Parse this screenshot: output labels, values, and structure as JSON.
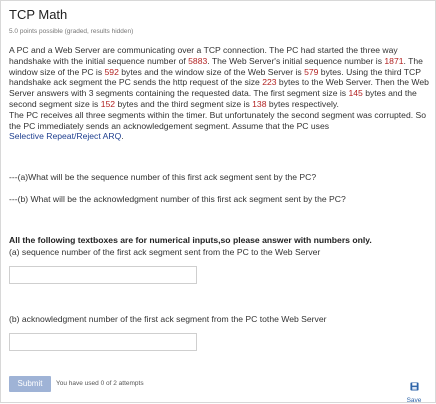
{
  "header": {
    "title": "TCP Math",
    "points": "5.0 points possible (graded, results hidden)"
  },
  "problem": {
    "s1": "A PC and a Web Server are communicating over a TCP connection. The PC had started the three way handshake with the initial sequence number of ",
    "pc_isn": "5883",
    "s2": ". The Web Server's initial sequence number is ",
    "server_isn": "1871",
    "s3": ". The window size of the PC is ",
    "pc_window": "592",
    "s4": " bytes and the window size of the Web Server is ",
    "server_window": "579",
    "s5": " bytes. Using the third TCP handshake ack segment the PC sends the http request of the size ",
    "request_size": "223",
    "s6": " bytes to the Web Server. Then the Web Server answers with 3 segments containing the requested data. The first segment size is ",
    "seg1": "145",
    "s7": " bytes and the second segment size is ",
    "seg2": "152",
    "s8": " bytes and the third segment size is ",
    "seg3": "138",
    "s9": " bytes respectively.",
    "p2": "The PC receives all three segments within the timer. But unfortunately the second segment was corrupted. So the PC immediately sends an acknowledgement segment. Assume that the PC uses ",
    "link_text": "Selective Repeat/Reject ARQ",
    "p2_end": "."
  },
  "questions": {
    "qa": "---(a)What will be the sequence number of this first ack segment sent by the PC?",
    "qb": "---(b) What will be the acknowledgment number of this first ack segment sent by the PC?",
    "instruction": "All the following textboxes are for numerical inputs,so please answer with numbers only.",
    "label_a": "(a) sequence number of the first ack segment sent from the PC to the Web Server",
    "label_b": "(b) acknowledgment number of the first ack segment from the PC tothe Web Server"
  },
  "inputs": {
    "a_value": "",
    "b_value": ""
  },
  "footer": {
    "submit_label": "Submit",
    "attempts": "You have used 0 of 2 attempts",
    "save_label": "Save"
  },
  "colors": {
    "number": "#b22222",
    "link": "#1f3f8f",
    "submit_bg": "#9fb3d6",
    "save_icon": "#2c63a8"
  },
  "icons": {
    "save": "floppy-disk-icon"
  }
}
